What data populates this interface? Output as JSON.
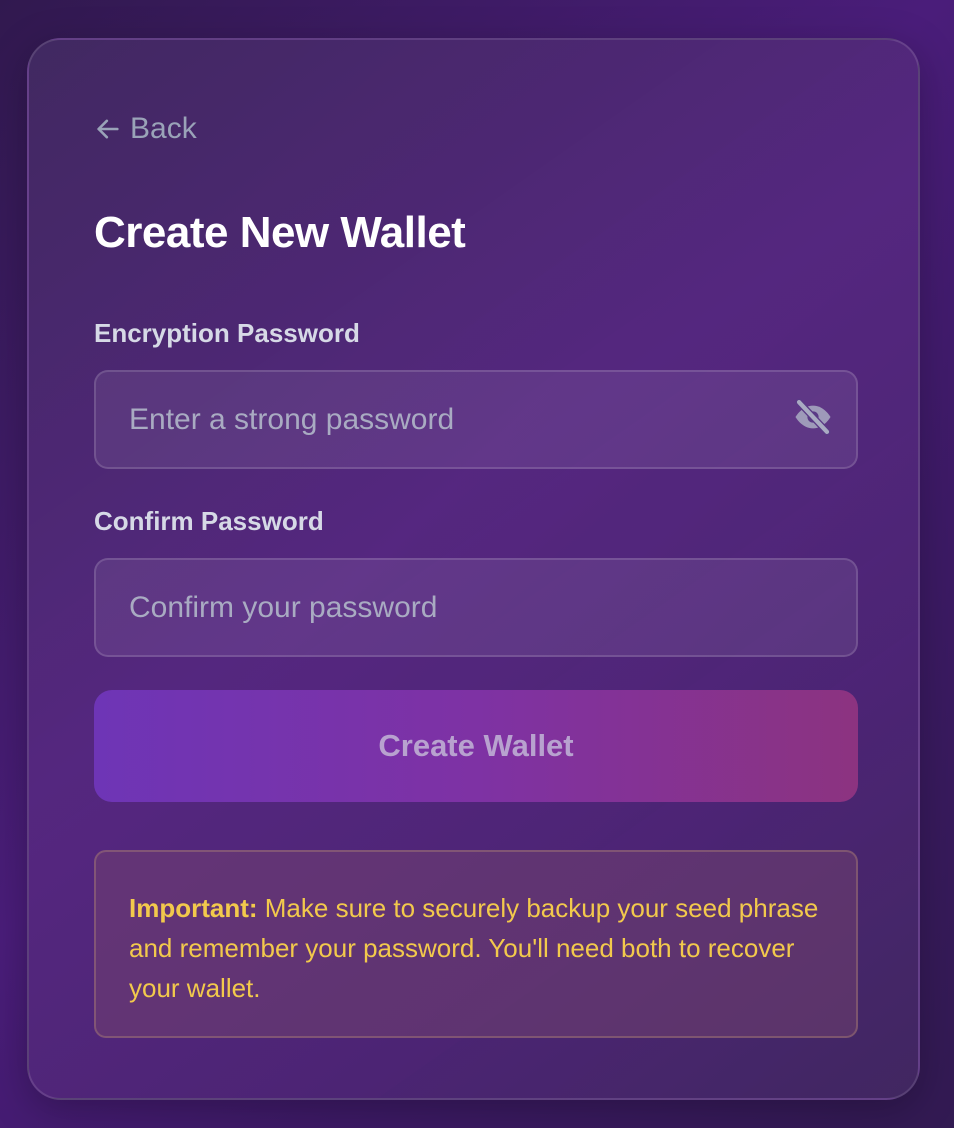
{
  "nav": {
    "back_label": "Back"
  },
  "page": {
    "title": "Create New Wallet"
  },
  "form": {
    "password": {
      "label": "Encryption Password",
      "placeholder": "Enter a strong password",
      "value": ""
    },
    "confirm": {
      "label": "Confirm Password",
      "placeholder": "Confirm your password",
      "value": ""
    },
    "submit_label": "Create Wallet"
  },
  "notice": {
    "prefix": "Important:",
    "text": " Make sure to securely backup your seed phrase and remember your password. You'll need both to recover your wallet."
  },
  "icons": {
    "back": "arrow-left-icon",
    "visibility": "eye-off-icon"
  },
  "colors": {
    "accent_start": "#6e35b6",
    "accent_end": "#8c3380",
    "warning_text": "#f2c94c"
  }
}
